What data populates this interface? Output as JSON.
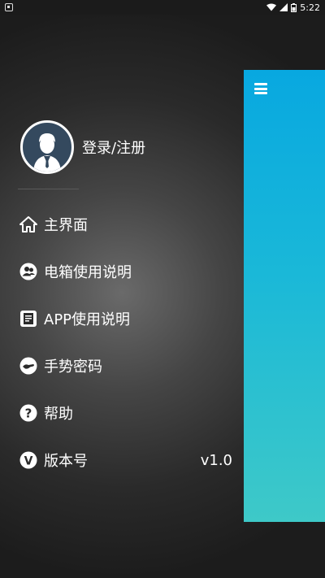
{
  "status_bar": {
    "time": "5:22"
  },
  "profile": {
    "login_label": "登录/注册"
  },
  "menu": [
    {
      "label": "主界面",
      "icon": "home-icon"
    },
    {
      "label": "电箱使用说明",
      "icon": "user-icon"
    },
    {
      "label": "APP使用说明",
      "icon": "document-icon"
    },
    {
      "label": "手势密码",
      "icon": "gesture-icon"
    },
    {
      "label": "帮助",
      "icon": "help-icon"
    },
    {
      "label": "版本号",
      "icon": "version-icon",
      "value": "v1.0"
    }
  ],
  "colors": {
    "panel_top": "#08a8e0",
    "panel_bottom": "#3ec9c8",
    "avatar_bg": "#34495e"
  }
}
